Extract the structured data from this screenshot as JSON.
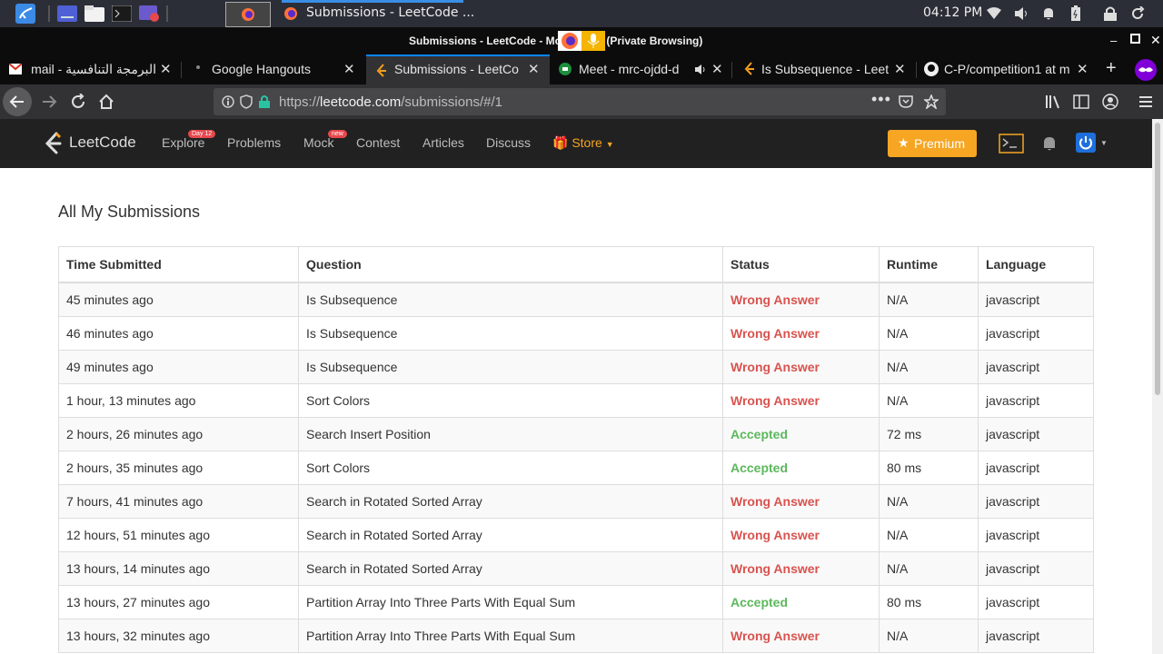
{
  "system_panel": {
    "active_window_title": "Submissions - LeetCode ...",
    "clock": "04:12 PM"
  },
  "window": {
    "title": "Submissions - LeetCode - Moz",
    "title_suffix": "(Private Browsing)"
  },
  "tabs": [
    {
      "label": "البرمجة التنافسية - mail",
      "active": false
    },
    {
      "label": "Google Hangouts",
      "active": false
    },
    {
      "label": "Submissions - LeetCo",
      "active": true
    },
    {
      "label": "Meet - mrc-ojdd-d",
      "active": false
    },
    {
      "label": "Is Subsequence - Leet",
      "active": false
    },
    {
      "label": "C-P/competition1 at m",
      "active": false
    }
  ],
  "url": {
    "prefix": "https://",
    "domain": "leetcode.com",
    "path": "/submissions/#/1"
  },
  "leetcode_nav": {
    "logo": "LeetCode",
    "links": [
      "Explore",
      "Problems",
      "Mock",
      "Contest",
      "Articles",
      "Discuss"
    ],
    "explore_badge": "Day 12",
    "mock_badge": "new",
    "store": "Store",
    "premium": "Premium"
  },
  "page": {
    "heading": "All My Submissions",
    "columns": [
      "Time Submitted",
      "Question",
      "Status",
      "Runtime",
      "Language"
    ],
    "rows": [
      [
        "45 minutes ago",
        "Is Subsequence",
        "Wrong Answer",
        "N/A",
        "javascript"
      ],
      [
        "46 minutes ago",
        "Is Subsequence",
        "Wrong Answer",
        "N/A",
        "javascript"
      ],
      [
        "49 minutes ago",
        "Is Subsequence",
        "Wrong Answer",
        "N/A",
        "javascript"
      ],
      [
        "1 hour, 13 minutes ago",
        "Sort Colors",
        "Wrong Answer",
        "N/A",
        "javascript"
      ],
      [
        "2 hours, 26 minutes ago",
        "Search Insert Position",
        "Accepted",
        "72 ms",
        "javascript"
      ],
      [
        "2 hours, 35 minutes ago",
        "Sort Colors",
        "Accepted",
        "80 ms",
        "javascript"
      ],
      [
        "7 hours, 41 minutes ago",
        "Search in Rotated Sorted Array",
        "Wrong Answer",
        "N/A",
        "javascript"
      ],
      [
        "12 hours, 51 minutes ago",
        "Search in Rotated Sorted Array",
        "Wrong Answer",
        "N/A",
        "javascript"
      ],
      [
        "13 hours, 14 minutes ago",
        "Search in Rotated Sorted Array",
        "Wrong Answer",
        "N/A",
        "javascript"
      ],
      [
        "13 hours, 27 minutes ago",
        "Partition Array Into Three Parts With Equal Sum",
        "Accepted",
        "80 ms",
        "javascript"
      ],
      [
        "13 hours, 32 minutes ago",
        "Partition Array Into Three Parts With Equal Sum",
        "Wrong Answer",
        "N/A",
        "javascript"
      ]
    ]
  },
  "colors": {
    "wrong": "#d9534f",
    "accepted": "#5cb85c",
    "premium": "#f6a623"
  }
}
